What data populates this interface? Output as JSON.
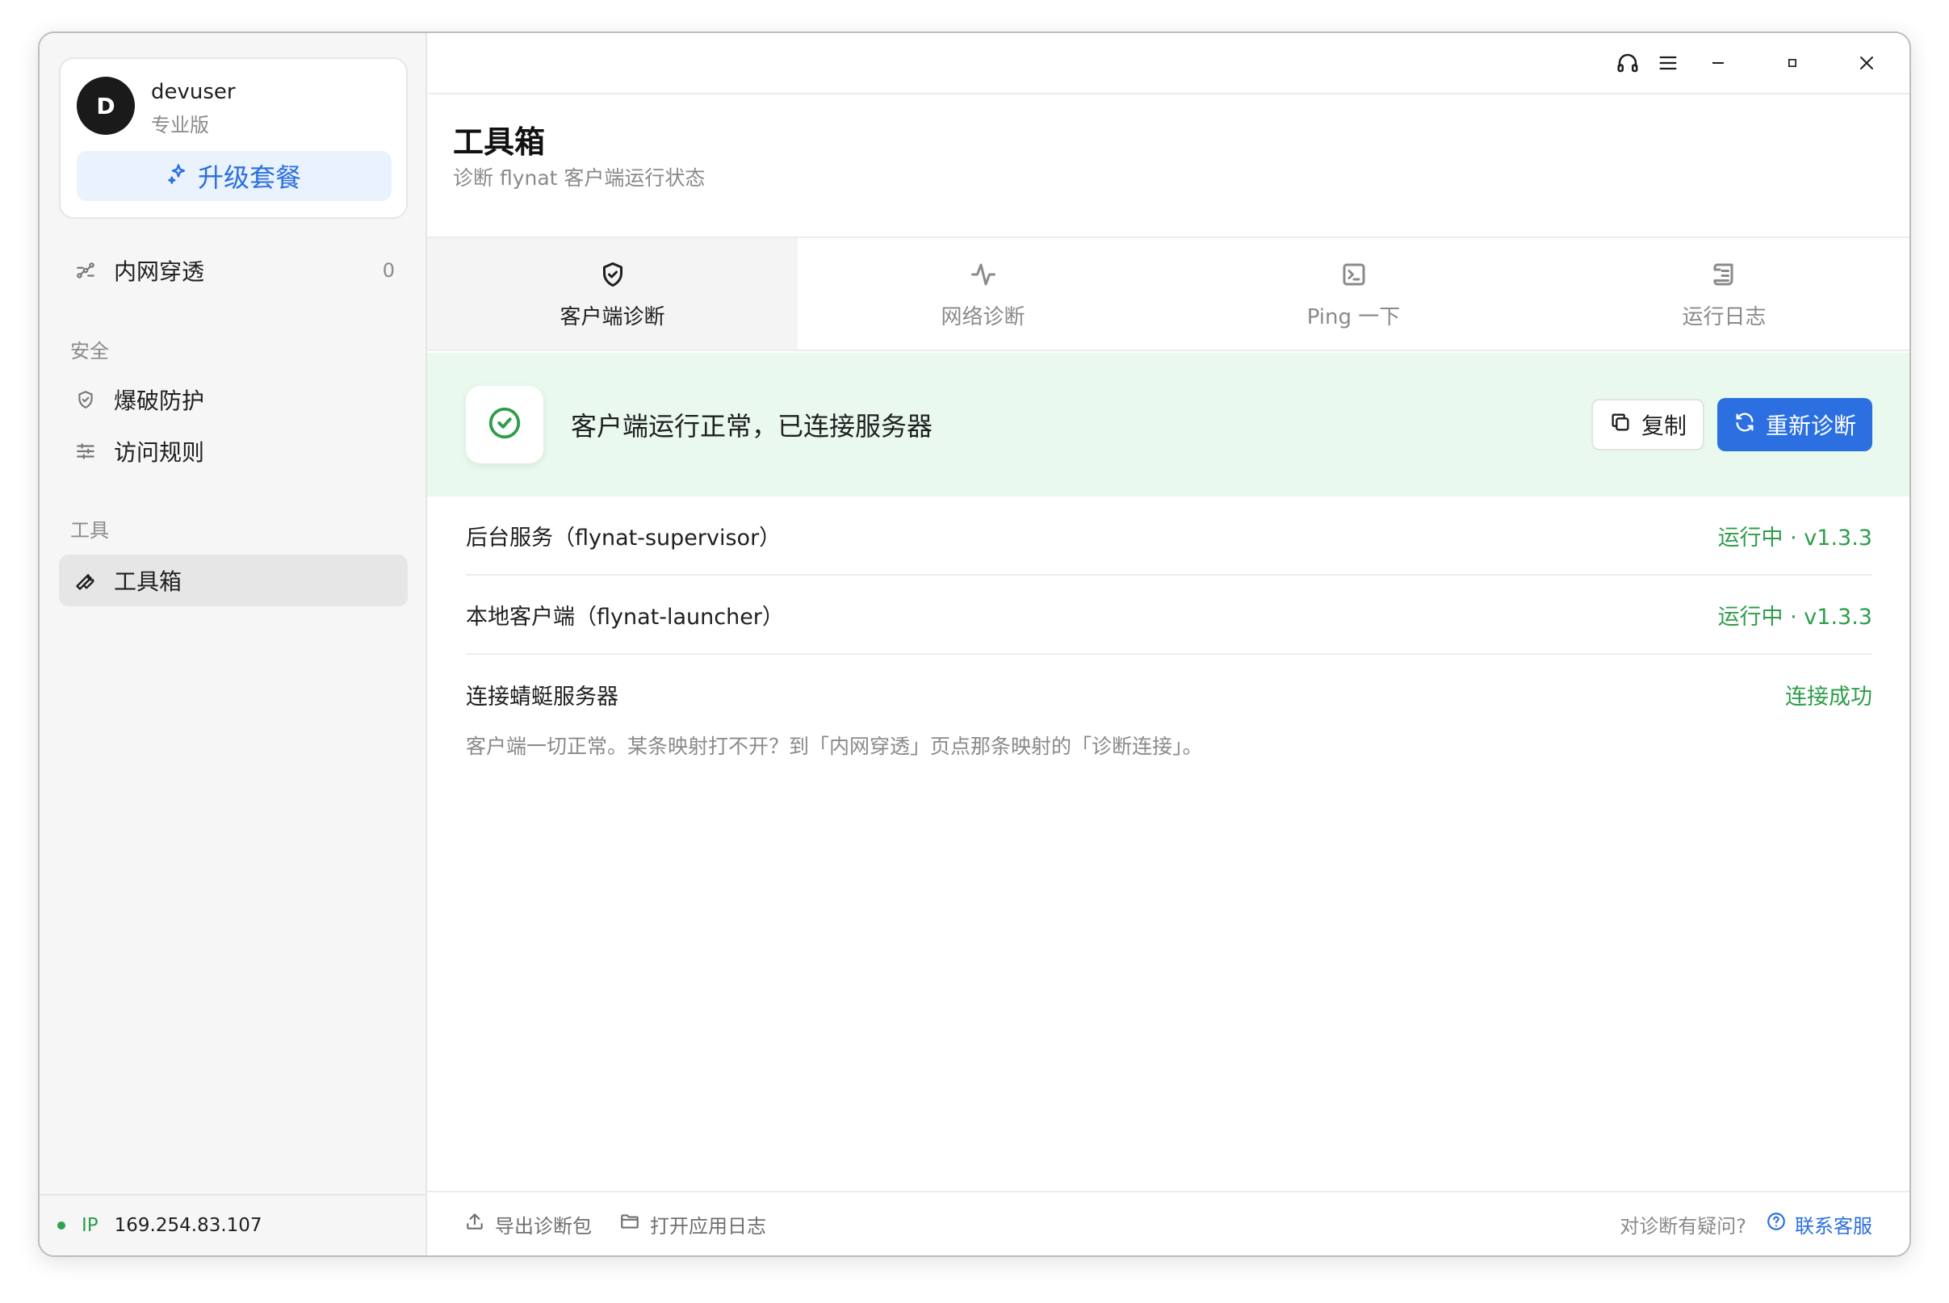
{
  "user": {
    "avatar_letter": "D",
    "name": "devuser",
    "plan": "专业版",
    "upgrade_label": "升级套餐"
  },
  "nav": {
    "tunnel": {
      "label": "内网穿透",
      "count": "0"
    },
    "security_section": "安全",
    "brute_force": "爆破防护",
    "access_rules": "访问规则",
    "tools_section": "工具",
    "toolbox": "工具箱"
  },
  "footer_left": {
    "ip_label": "IP",
    "ip_value": "169.254.83.107"
  },
  "page": {
    "title": "工具箱",
    "subtitle": "诊断 flynat 客户端运行状态"
  },
  "tabs": [
    {
      "label": "客户端诊断",
      "icon": "shield-check-icon",
      "active": true
    },
    {
      "label": "网络诊断",
      "icon": "activity-icon",
      "active": false
    },
    {
      "label": "Ping 一下",
      "icon": "terminal-icon",
      "active": false
    },
    {
      "label": "运行日志",
      "icon": "scroll-icon",
      "active": false
    }
  ],
  "status": {
    "message": "客户端运行正常，已连接服务器",
    "copy_label": "复制",
    "rediagnose_label": "重新诊断"
  },
  "checks": [
    {
      "name": "后台服务（flynat-supervisor）",
      "status": "运行中 · v1.3.3"
    },
    {
      "name": "本地客户端（flynat-launcher）",
      "status": "运行中 · v1.3.3"
    },
    {
      "name": "连接蜻蜓服务器",
      "status": "连接成功"
    }
  ],
  "hint": "客户端一切正常。某条映射打不开？到「内网穿透」页点那条映射的「诊断连接」。",
  "footer": {
    "export_label": "导出诊断包",
    "open_log_label": "打开应用日志",
    "question": "对诊断有疑问?",
    "contact_label": "联系客服"
  },
  "colors": {
    "accent": "#2b6fe0",
    "success": "#2e9d4a",
    "banner_bg": "#eaf9ee"
  }
}
